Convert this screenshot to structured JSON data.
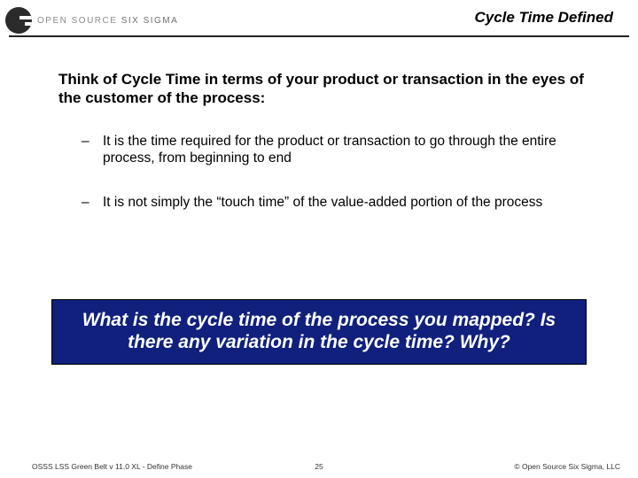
{
  "header": {
    "logo_text_a": "OPEN SOURCE",
    "logo_text_b": "SIX SIGMA",
    "title": "Cycle Time Defined"
  },
  "body": {
    "intro": "Think of Cycle Time in terms of your product or transaction in the eyes of the customer of the process:",
    "bullets": [
      "It is the time required for the product or transaction to go through the entire process, from beginning to end",
      "It is not simply the “touch time” of the value-added portion of the process"
    ],
    "callout": "What is the cycle time of the process you mapped? Is there any variation in the cycle time?  Why?"
  },
  "footer": {
    "left": "OSSS LSS Green Belt v 11.0 XL - Define Phase",
    "page": "25",
    "right": "© Open Source Six Sigma, LLC"
  }
}
